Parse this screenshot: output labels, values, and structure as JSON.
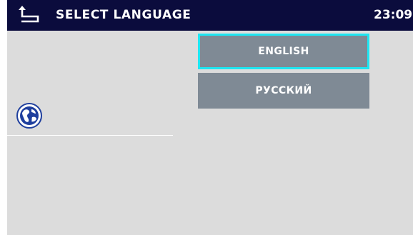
{
  "header": {
    "title": "SELECT LANGUAGE",
    "time": "23:09",
    "back_icon": "back-arrow-icon"
  },
  "languages": [
    {
      "label": "ENGLISH",
      "selected": true
    },
    {
      "label": "РУССКИЙ",
      "selected": false
    }
  ],
  "side": {
    "icon": "globe-icon"
  },
  "colors": {
    "header_bg": "#0b0c3d",
    "content_bg": "#dcdcdc",
    "button_bg": "#7f8a95",
    "selection_border": "#1ee6f2",
    "globe_blue": "#1f3f9e"
  }
}
